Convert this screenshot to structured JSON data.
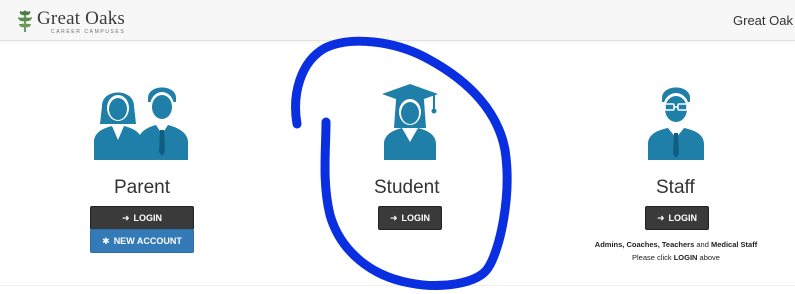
{
  "header": {
    "logo_title": "Great Oaks",
    "logo_subtitle": "CAREER CAMPUSES",
    "right_text": "Great Oak"
  },
  "cards": {
    "parent": {
      "label": "Parent",
      "login_label": "LOGIN",
      "new_account_label": "NEW ACCOUNT",
      "icon": "parent-avatar-icon"
    },
    "student": {
      "label": "Student",
      "login_label": "LOGIN",
      "icon": "student-avatar-icon"
    },
    "staff": {
      "label": "Staff",
      "login_label": "LOGIN",
      "icon": "staff-avatar-icon",
      "note_prefix": "Admins, Coaches, Teachers",
      "note_and": " and ",
      "note_bold2": "Medical Staff",
      "note2_prefix": "Please click ",
      "note2_bold": "LOGIN",
      "note2_suffix": " above"
    }
  },
  "colors": {
    "avatar_blue": "#1f7fa8",
    "header_bg": "#f7f7f7",
    "button_dark": "#3a3a3a",
    "button_blue": "#337ab7",
    "annotation_blue": "#0a2fe0"
  }
}
